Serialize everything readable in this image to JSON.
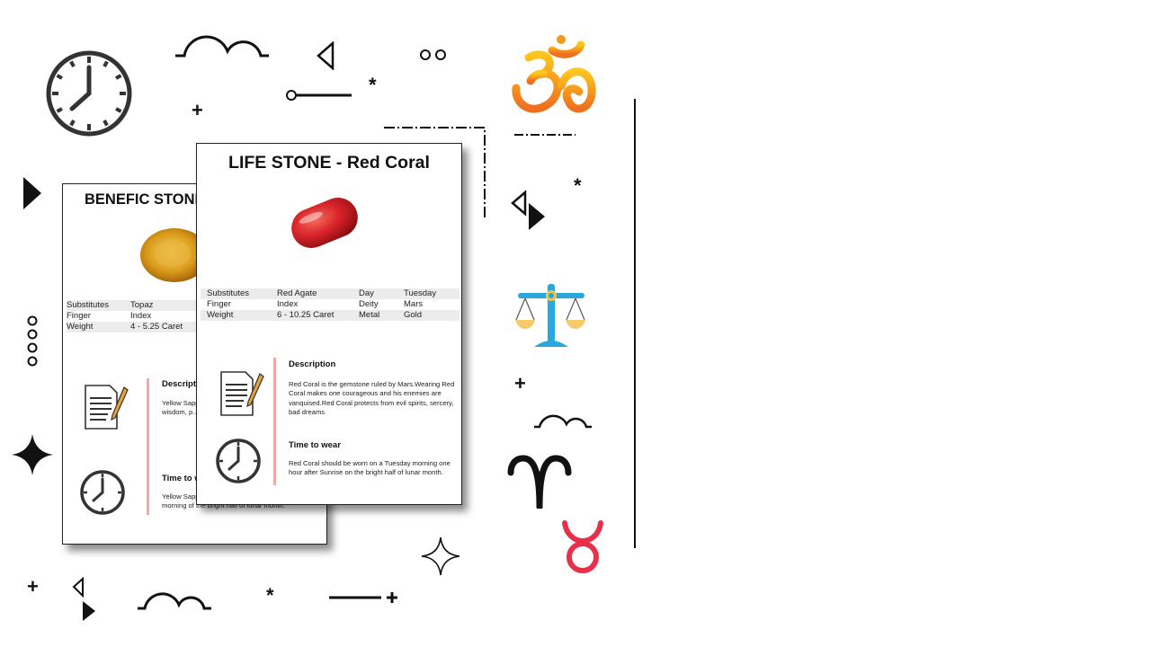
{
  "cards": [
    {
      "title": "BENEFIC STONE",
      "specs": [
        {
          "k1": "Substitutes",
          "v1": "Topaz"
        },
        {
          "k1": "Finger",
          "v1": "Index"
        },
        {
          "k1": "Weight",
          "v1": "4 - 5.25 Caret"
        }
      ],
      "description_title": "Description",
      "description_text": "Yellow Sapphire ... Wearing Yellow Sapphire ... wisdom, p... fame. Yello...",
      "time_title": "Time to wear",
      "time_text": "Yellow Sapphire should be worn on a Thursday morning of the bright half of lunar month."
    },
    {
      "title": "LIFE STONE - Red Coral",
      "specs": [
        {
          "k1": "Substitutes",
          "v1": "Red Agate",
          "k2": "Day",
          "v2": "Tuesday"
        },
        {
          "k1": "Finger",
          "v1": "Index",
          "k2": "Deity",
          "v2": "Mars"
        },
        {
          "k1": "Weight",
          "v1": "6 - 10.25 Caret",
          "k2": "Metal",
          "v2": "Gold"
        }
      ],
      "description_title": "Description",
      "description_text": "Red Coral is the gemstone ruled by Mars.Wearing Red Coral makes one courageous and his enemies are vanquised.Red Coral protects from evil spirits, sercery, bad dreams",
      "time_title": "Time  to  wear",
      "time_text": "Red Coral should be worn on a Tuesday morning one hour after Sunrise on the bright half of lunar month."
    }
  ],
  "icons": [
    "clock-icon",
    "om-icon",
    "libra-scale-icon",
    "aries-icon",
    "taurus-icon",
    "document-pen-icon",
    "sparkle-icon"
  ],
  "colors": {
    "coral": "#d9242a",
    "om_orange": "#f39a1a",
    "taurus": "#e8304a",
    "scale_blue": "#29a8e0",
    "divider": "#f2a8a3"
  }
}
